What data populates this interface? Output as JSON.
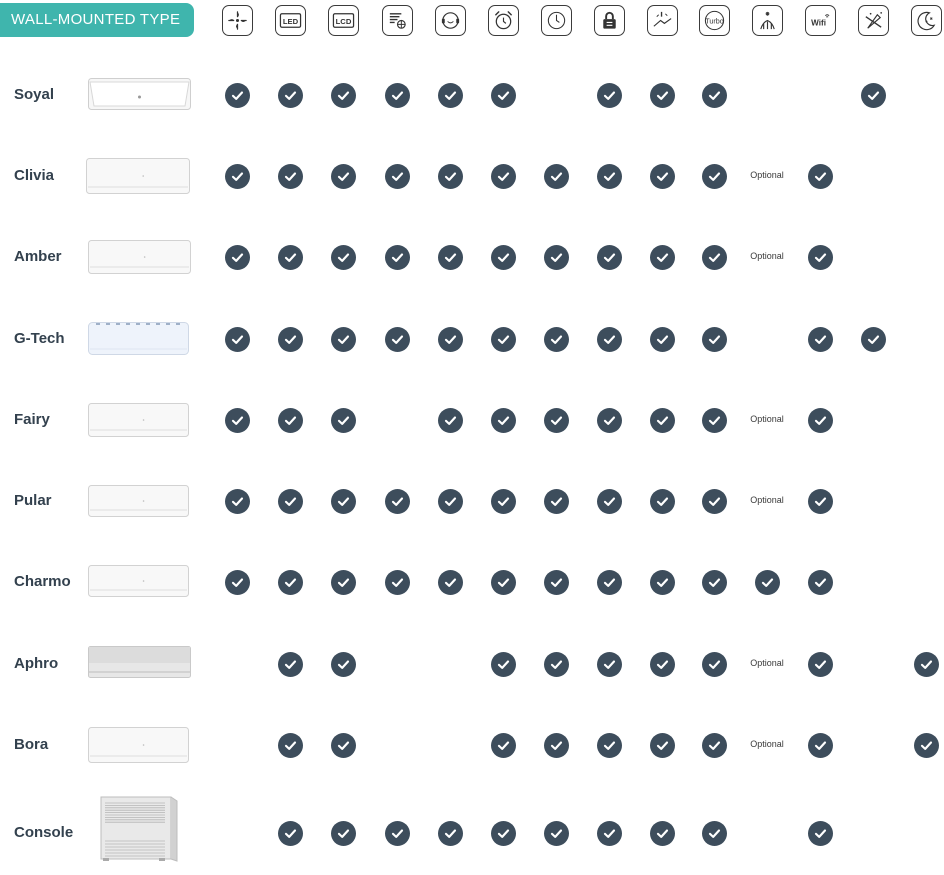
{
  "title": "WALL-MOUNTED TYPE",
  "columns": [
    {
      "icon": "fan-icon"
    },
    {
      "icon": "led-display-icon",
      "text": "LED"
    },
    {
      "icon": "lcd-display-icon",
      "text": "LCD"
    },
    {
      "icon": "fan-speed-icon"
    },
    {
      "icon": "quiet-mode-icon"
    },
    {
      "icon": "alarm-clock-icon"
    },
    {
      "icon": "timer-icon"
    },
    {
      "icon": "child-lock-icon"
    },
    {
      "icon": "self-clean-icon"
    },
    {
      "icon": "turbo-icon",
      "text": "Turbo"
    },
    {
      "icon": "cold-plasma-icon"
    },
    {
      "icon": "wifi-icon",
      "text": "Wifi"
    },
    {
      "icon": "anti-mildew-icon"
    },
    {
      "icon": "sleep-mode-icon"
    }
  ],
  "rows": [
    {
      "name": "Soyal",
      "cells": [
        "check",
        "check",
        "check",
        "check",
        "check",
        "check",
        "",
        "check",
        "check",
        "check",
        "",
        "",
        "check",
        ""
      ]
    },
    {
      "name": "Clivia",
      "cells": [
        "check",
        "check",
        "check",
        "check",
        "check",
        "check",
        "check",
        "check",
        "check",
        "check",
        "Optional",
        "check",
        "",
        ""
      ]
    },
    {
      "name": "Amber",
      "cells": [
        "check",
        "check",
        "check",
        "check",
        "check",
        "check",
        "check",
        "check",
        "check",
        "check",
        "Optional",
        "check",
        "",
        ""
      ]
    },
    {
      "name": "G-Tech",
      "cells": [
        "check",
        "check",
        "check",
        "check",
        "check",
        "check",
        "check",
        "check",
        "check",
        "check",
        "",
        "check",
        "check",
        ""
      ]
    },
    {
      "name": "Fairy",
      "cells": [
        "check",
        "check",
        "check",
        "",
        "check",
        "check",
        "check",
        "check",
        "check",
        "check",
        "Optional",
        "check",
        "",
        ""
      ]
    },
    {
      "name": "Pular",
      "cells": [
        "check",
        "check",
        "check",
        "check",
        "check",
        "check",
        "check",
        "check",
        "check",
        "check",
        "Optional",
        "check",
        "",
        ""
      ]
    },
    {
      "name": "Charmo",
      "cells": [
        "check",
        "check",
        "check",
        "check",
        "check",
        "check",
        "check",
        "check",
        "check",
        "check",
        "check",
        "check",
        "",
        ""
      ]
    },
    {
      "name": "Aphro",
      "cells": [
        "",
        "check",
        "check",
        "",
        "",
        "check",
        "check",
        "check",
        "check",
        "check",
        "Optional",
        "check",
        "",
        "check"
      ]
    },
    {
      "name": "Bora",
      "cells": [
        "",
        "check",
        "check",
        "",
        "",
        "check",
        "check",
        "check",
        "check",
        "check",
        "Optional",
        "check",
        "",
        "check"
      ]
    },
    {
      "name": "Console",
      "cells": [
        "",
        "check",
        "check",
        "check",
        "check",
        "check",
        "check",
        "check",
        "check",
        "check",
        "",
        "check",
        "",
        ""
      ]
    }
  ]
}
